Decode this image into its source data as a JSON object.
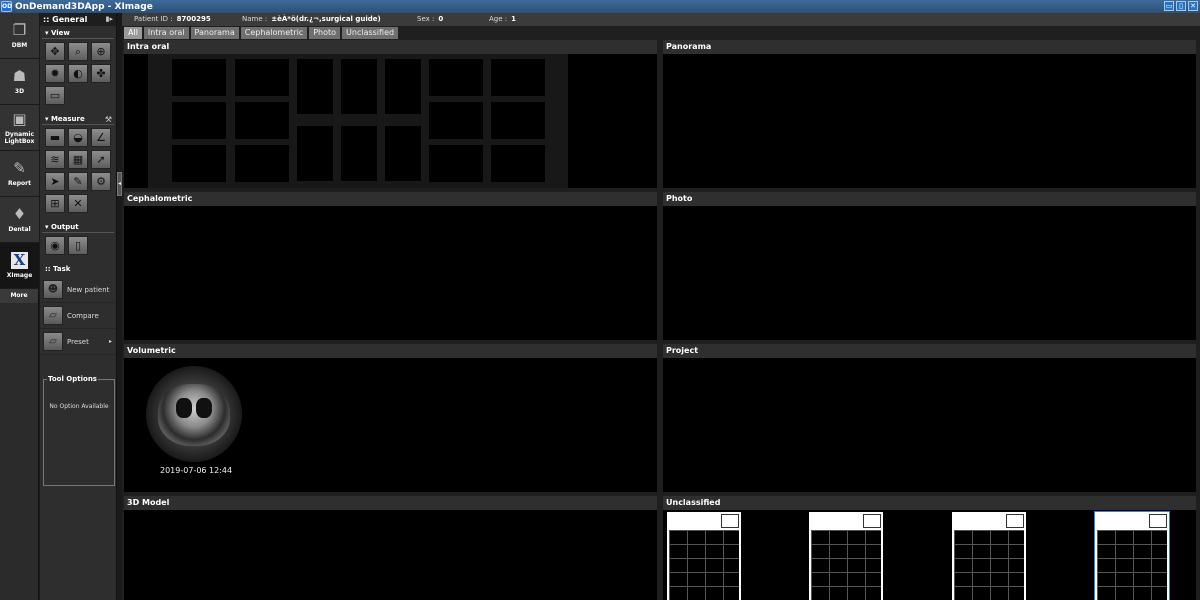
{
  "window": {
    "title": "OnDemand3DApp - XImage",
    "app_icon": "OD",
    "buttons": [
      "▭",
      "▯",
      "✕"
    ]
  },
  "mainbar": {
    "items": [
      {
        "label": "DBM",
        "icon": "database-icon",
        "glyph": "❐"
      },
      {
        "label": "3D",
        "icon": "skull-3d-icon",
        "glyph": "☗"
      },
      {
        "label": "Dynamic\nLightBox",
        "icon": "lightbox-icon",
        "glyph": "▣"
      },
      {
        "label": "Report",
        "icon": "report-icon",
        "glyph": "✎"
      },
      {
        "label": "Dental",
        "icon": "tooth-icon",
        "glyph": "♦"
      },
      {
        "label": "XImage",
        "icon": "ximage-icon",
        "glyph": "X"
      }
    ],
    "more_label": "More"
  },
  "toolpanel": {
    "title": ":: General",
    "sections": {
      "view": "View",
      "measure": "Measure",
      "output": "Output",
      "task": ":: Task"
    },
    "view_tools": [
      "move-icon",
      "zoom-icon",
      "magnifier-icon",
      "window-level-icon",
      "contrast-icon",
      "rotate-icon",
      "annotation-icon"
    ],
    "measure_tools": [
      "ruler-icon",
      "area-icon",
      "angle-icon",
      "profile-icon",
      "density-icon",
      "arrow-icon",
      "select-icon",
      "pen-icon",
      "settings-icon",
      "caliper-icon",
      "delete-icon"
    ],
    "output_tools": [
      "capture-icon",
      "print-icon"
    ],
    "tasks": [
      {
        "label": "New patient",
        "icon": "patient-icon"
      },
      {
        "label": "Compare",
        "icon": "folder-icon"
      },
      {
        "label": "Preset",
        "icon": "folder-icon"
      }
    ],
    "tool_options": {
      "title": "Tool Options",
      "text": "No Option Available"
    }
  },
  "patient": {
    "id_label": "Patient ID :",
    "id": "8700295",
    "name_label": "Name :",
    "name": "±èÀ*ö(dr.¿¬,surgical guide)",
    "sex_label": "Sex :",
    "sex": "0",
    "age_label": "Age :",
    "age": "1"
  },
  "tabs": [
    "All",
    "Intra oral",
    "Panorama",
    "Cephalometric",
    "Photo",
    "Unclassified"
  ],
  "panels": {
    "intra_oral": "Intra oral",
    "panorama": "Panorama",
    "cephalometric": "Cephalometric",
    "photo": "Photo",
    "volumetric": "Volumetric",
    "project": "Project",
    "model_3d": "3D Model",
    "unclassified": "Unclassified"
  },
  "volumetric_item": {
    "date": "2019-07-06 12:44"
  },
  "accent_color": "#3b82d6"
}
